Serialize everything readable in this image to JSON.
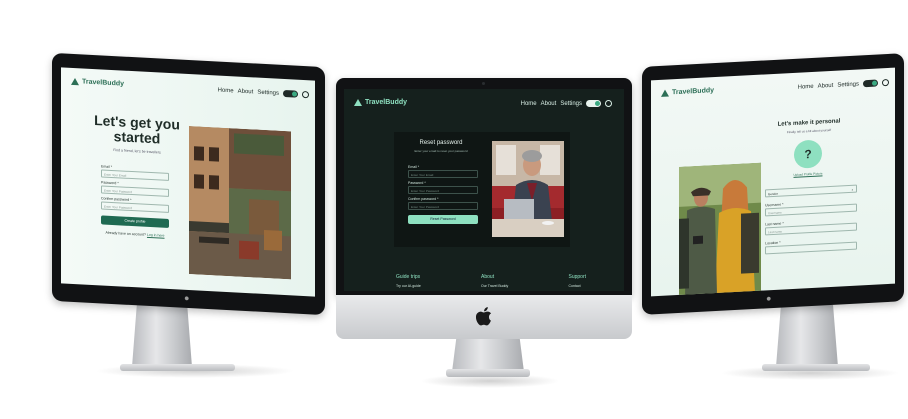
{
  "brand": {
    "name": "TravelBuddy"
  },
  "nav": {
    "home": "Home",
    "about": "About",
    "settings": "Settings",
    "toggle_label": "Dark"
  },
  "left": {
    "title_line1": "Let's get you",
    "title_line2": "started",
    "subtitle": "Find a friend, let's be travellers",
    "email_label": "Email *",
    "email_placeholder": "Enter Your Email",
    "password_label": "Password *",
    "password_placeholder": "Enter Your Password",
    "confirm_label": "Confirm password *",
    "confirm_placeholder": "Enter Your Password",
    "submit": "Create profile",
    "footer_text": "Already have an account?",
    "login_link": "Log in here"
  },
  "center": {
    "title": "Reset password",
    "subtitle": "Enter your email to reset your password",
    "email_label": "Email *",
    "email_placeholder": "Enter Your Email",
    "password_label": "Password *",
    "password_placeholder": "Enter Your Password",
    "confirm_label": "Confirm password *",
    "confirm_placeholder": "Enter Your Password",
    "submit": "Reset Password",
    "footer": [
      {
        "heading": "Guide trips",
        "item": "Try our AI-guide"
      },
      {
        "heading": "About",
        "item": "Our Travel Buddy"
      },
      {
        "heading": "Support",
        "item": "Contact"
      }
    ]
  },
  "right": {
    "title": "Let's make it personal",
    "subtitle": "Finally, tell us a bit about yourself",
    "avatar_glyph": "?",
    "upload_label": "Upload Profile Picture",
    "gender_label": "Gender",
    "username_label": "Username *",
    "username_placeholder": "Username",
    "lastname_label": "Last name *",
    "lastname_placeholder": "Last name",
    "location_label": "Location *"
  },
  "colors": {
    "accent": "#3aa981",
    "accent_light": "#8ee0c0",
    "dark_bg": "#15201d",
    "button_dark": "#1f6a52"
  }
}
